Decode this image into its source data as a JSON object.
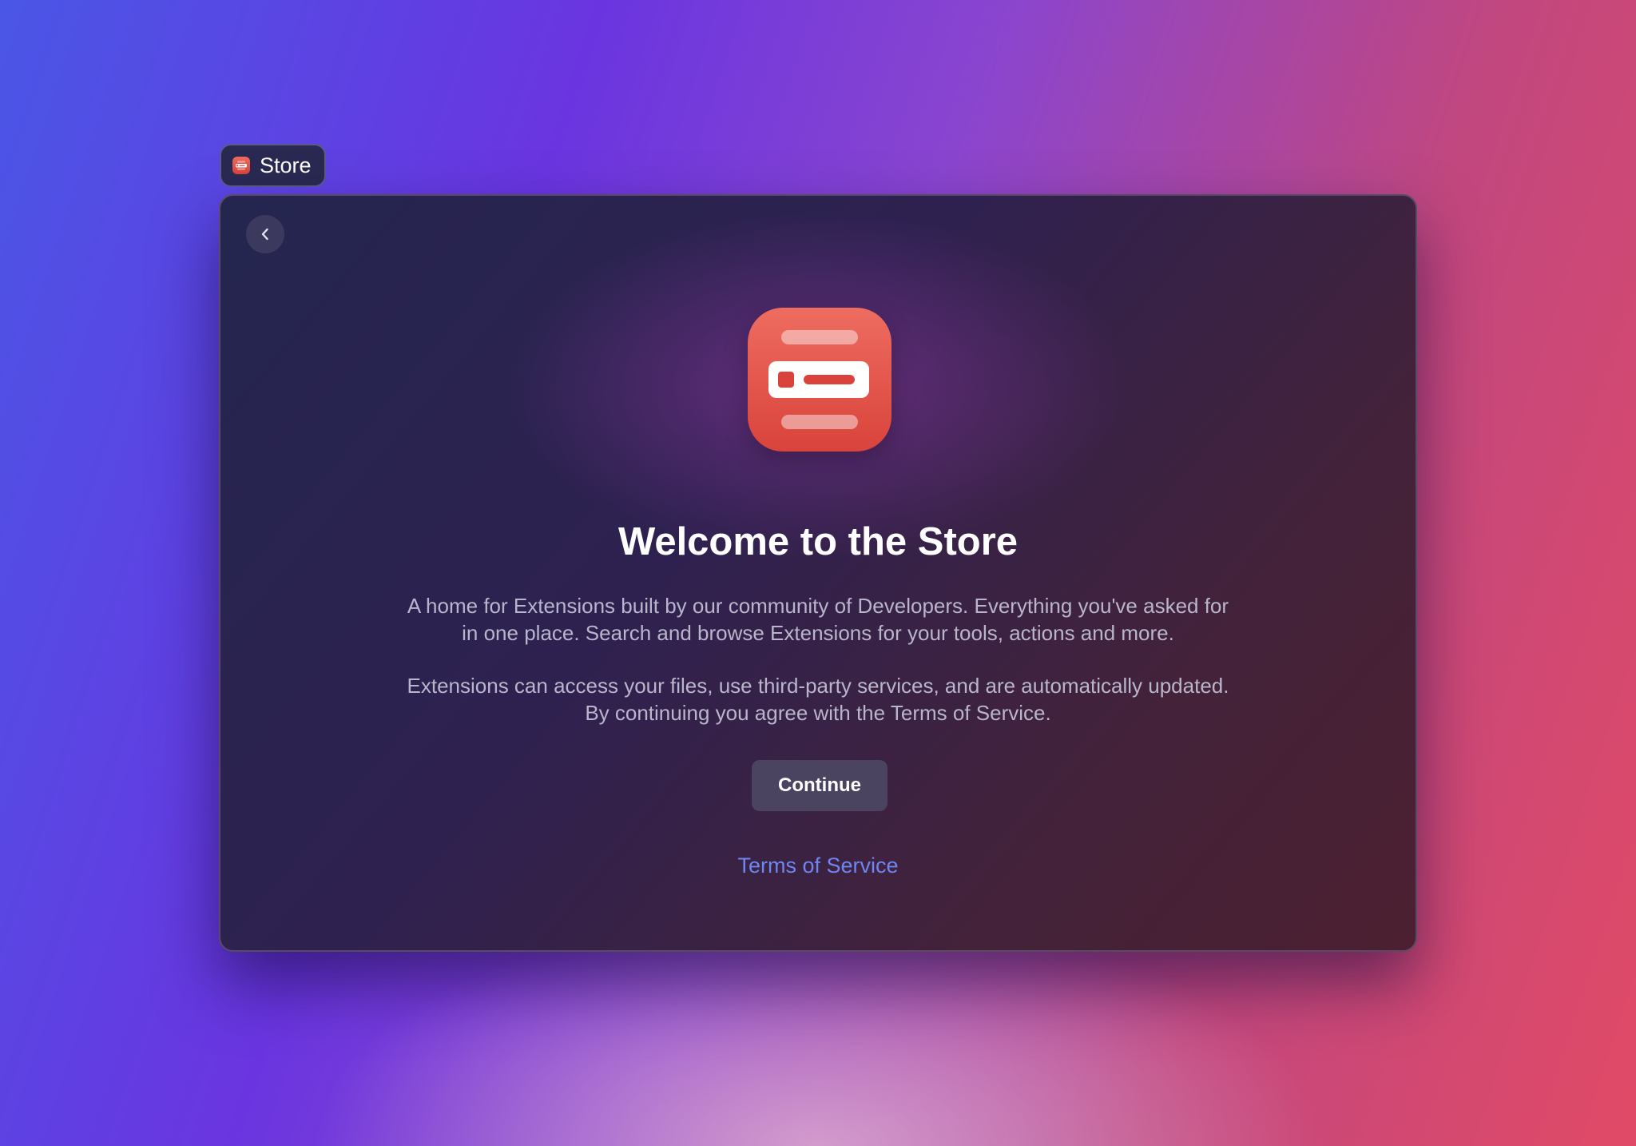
{
  "window_tag": {
    "label": "Store",
    "icon": "store-icon"
  },
  "welcome": {
    "back_icon": "chevron-left-icon",
    "hero_icon": "store-icon",
    "title": "Welcome to the Store",
    "paragraph1_line1": "A home for Extensions built by our community of Developers. Everything you've asked for",
    "paragraph1_line2": "in one place. Search and browse Extensions for your tools, actions and more.",
    "paragraph2_line1": "Extensions can access your files, use third-party services, and are automatically updated.",
    "paragraph2_line2": "By continuing you agree with the Terms of Service.",
    "continue_label": "Continue",
    "terms_link": "Terms of Service"
  },
  "colors": {
    "accent_link": "#6d86f0",
    "icon_red": "#e0534a",
    "button_bg": "#4a4461"
  }
}
